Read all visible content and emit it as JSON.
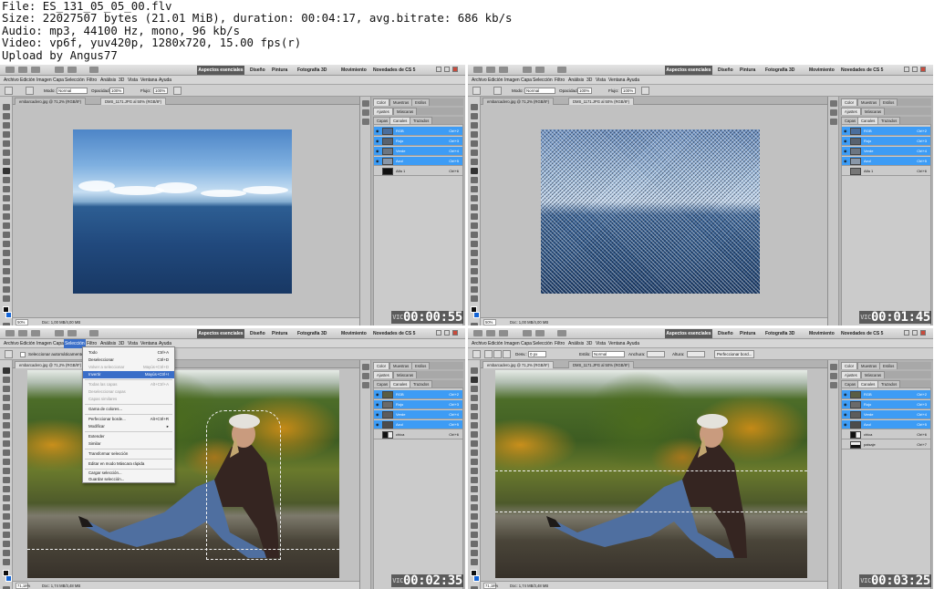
{
  "header": {
    "line1": "File: ES_131_05_05_00.flv",
    "line2": "Size: 22027507 bytes (21.01 MiB), duration: 00:04:17, avg.bitrate: 686 kb/s",
    "line3": "Audio: mp3, 44100 Hz, mono, 96 kb/s",
    "line4": "Video: vp6f, yuv420p, 1280x720, 15.00 fps(r)",
    "line5": "Upload by Angus77"
  },
  "app": {
    "workspaces": [
      "Aspectos esenciales",
      "Diseño",
      "Pintura",
      "Fotografía",
      "3D",
      "Movimiento",
      "Novedades de CS 5"
    ],
    "menu": [
      "Archivo",
      "Edición",
      "Imagen",
      "Capa",
      "Selección",
      "Filtro",
      "Análisis",
      "3D",
      "Vista",
      "Ventana",
      "Ayuda"
    ],
    "brush_options": {
      "mode_label": "Modo:",
      "mode_value": "Normal",
      "opacity_label": "Opacidad:",
      "opacity_value": "100%",
      "flow_label": "Flujo:",
      "flow_value": "100%"
    },
    "panel_tabs_top": [
      "Color",
      "Muestras",
      "Estilos"
    ],
    "panel_tabs_mid": [
      "Ajustes",
      "Máscaras"
    ],
    "layers_tabs": [
      "Capas",
      "Canales",
      "Trazados"
    ]
  },
  "thumbnails": [
    {
      "timestamp": "00:00:55",
      "doc_tabs": [
        "embarcadero.jpg @ 71,2% (RGB/8*)",
        "DMS_1171.JPG al 50% (RGB/8*)"
      ],
      "zoom": "50%",
      "doc_info": "Doc: 1,00 MB/4,00 MB",
      "channels": [
        {
          "name": "RGB",
          "shortcut": "Ctrl+2"
        },
        {
          "name": "Rojo",
          "shortcut": "Ctrl+3"
        },
        {
          "name": "Verde",
          "shortcut": "Ctrl+4"
        },
        {
          "name": "Azul",
          "shortcut": "Ctrl+5"
        },
        {
          "name": "Alfa 1",
          "shortcut": "Ctrl+6"
        }
      ]
    },
    {
      "timestamp": "00:01:45",
      "doc_tabs": [
        "embarcadero.jpg @ 71,2% (RGB/8*)",
        "DMS_1171.JPG al 50% (RGB/8*)"
      ],
      "zoom": "50%",
      "doc_info": "Doc: 1,00 MB/4,00 MB",
      "channels": [
        {
          "name": "RGB",
          "shortcut": "Ctrl+2"
        },
        {
          "name": "Rojo",
          "shortcut": "Ctrl+3"
        },
        {
          "name": "Verde",
          "shortcut": "Ctrl+4"
        },
        {
          "name": "Azul",
          "shortcut": "Ctrl+5"
        },
        {
          "name": "Alfa 1",
          "shortcut": "Ctrl+6"
        }
      ]
    },
    {
      "timestamp": "00:02:35",
      "doc_tabs": [
        "embarcadero.jpg @ 71,2% (RGB/8*)"
      ],
      "zoom": "71,18%",
      "doc_info": "Doc: 1,74 MB/3,48 MB",
      "options_checkbox": "Seleccionar automáticamente",
      "open_menu": "Selección",
      "menu_items": [
        {
          "label": "Todo",
          "key": "Ctrl+A",
          "state": "normal"
        },
        {
          "label": "Deseleccionar",
          "key": "Ctrl+D",
          "state": "normal"
        },
        {
          "label": "Volver a seleccionar",
          "key": "Mayús+Ctrl+D",
          "state": "disabled"
        },
        {
          "label": "Invertir",
          "key": "Mayús+Ctrl+I",
          "state": "highlight"
        },
        {
          "label": "",
          "key": "",
          "state": "separator"
        },
        {
          "label": "Todas las capas",
          "key": "Alt+Ctrl+A",
          "state": "disabled"
        },
        {
          "label": "Deseleccionar capas",
          "key": "",
          "state": "disabled"
        },
        {
          "label": "Capas similares",
          "key": "",
          "state": "disabled"
        },
        {
          "label": "",
          "key": "",
          "state": "separator"
        },
        {
          "label": "Gama de colores...",
          "key": "",
          "state": "normal"
        },
        {
          "label": "",
          "key": "",
          "state": "separator"
        },
        {
          "label": "Perfeccionar borde...",
          "key": "Alt+Ctrl+R",
          "state": "normal"
        },
        {
          "label": "Modificar",
          "key": "",
          "state": "normal"
        },
        {
          "label": "",
          "key": "",
          "state": "separator"
        },
        {
          "label": "Extender",
          "key": "",
          "state": "normal"
        },
        {
          "label": "Similar",
          "key": "",
          "state": "normal"
        },
        {
          "label": "",
          "key": "",
          "state": "separator"
        },
        {
          "label": "Transformar selección",
          "key": "",
          "state": "normal"
        },
        {
          "label": "",
          "key": "",
          "state": "separator"
        },
        {
          "label": "Editar en modo Máscara rápida",
          "key": "",
          "state": "normal"
        },
        {
          "label": "",
          "key": "",
          "state": "separator"
        },
        {
          "label": "Cargar selección...",
          "key": "",
          "state": "normal"
        },
        {
          "label": "Guardar selección...",
          "key": "",
          "state": "normal"
        }
      ],
      "channels": [
        {
          "name": "RGB",
          "shortcut": "Ctrl+2"
        },
        {
          "name": "Rojo",
          "shortcut": "Ctrl+3"
        },
        {
          "name": "Verde",
          "shortcut": "Ctrl+4"
        },
        {
          "name": "Azul",
          "shortcut": "Ctrl+5"
        },
        {
          "name": "chica",
          "shortcut": "Ctrl+6"
        }
      ]
    },
    {
      "timestamp": "00:03:25",
      "doc_tabs": [
        "embarcadero.jpg @ 71,2% (RGB/8*)",
        "DMS_1171.JPG al 50% (RGB/8*)"
      ],
      "zoom": "71,18%",
      "doc_info": "Doc: 1,74 MB/3,48 MB",
      "options": {
        "desv_label": "Desv.:",
        "desv_value": "0 px",
        "estilo_label": "Estilo:",
        "estilo_value": "Normal",
        "anchura_label": "Anchura:",
        "altura_label": "Altura:",
        "refine_button": "Perfeccionar bord..."
      },
      "channels": [
        {
          "name": "RGB",
          "shortcut": "Ctrl+2"
        },
        {
          "name": "Rojo",
          "shortcut": "Ctrl+3"
        },
        {
          "name": "Verde",
          "shortcut": "Ctrl+4"
        },
        {
          "name": "Azul",
          "shortcut": "Ctrl+5"
        },
        {
          "name": "chica",
          "shortcut": "Ctrl+6"
        },
        {
          "name": "paisaje",
          "shortcut": "Ctrl+7"
        }
      ]
    }
  ],
  "colors": {
    "selection": "#3d9cf5",
    "essentials_active": "#5a5a5a",
    "background_swatch": "#1565d6"
  }
}
